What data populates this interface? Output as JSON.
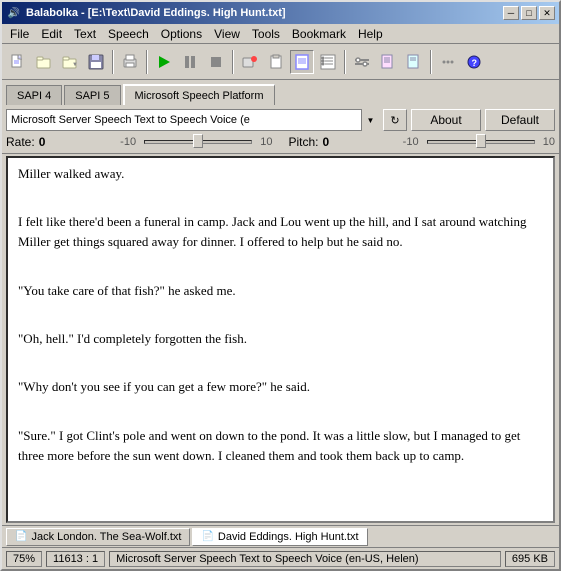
{
  "window": {
    "title": "Balabolka - [E:\\Text\\David Eddings. High Hunt.txt]",
    "icon": "🔊"
  },
  "titlebar": {
    "minimize_label": "─",
    "maximize_label": "□",
    "close_label": "✕"
  },
  "menu": {
    "items": [
      "File",
      "Edit",
      "Text",
      "Speech",
      "Options",
      "View",
      "Tools",
      "Bookmark",
      "Help"
    ]
  },
  "tabs": {
    "sapi4": "SAPI 4",
    "sapi5": "SAPI 5",
    "microsoft_speech": "Microsoft Speech Platform"
  },
  "voice": {
    "selected": "Microsoft Server Speech Text to Speech Voice (e",
    "about_label": "About",
    "default_label": "Default",
    "rate_label": "Rate:",
    "rate_value": "0",
    "rate_min": "-10",
    "rate_max": "10",
    "pitch_label": "Pitch:",
    "pitch_value": "0",
    "pitch_min": "-10",
    "pitch_max": "10"
  },
  "text_content": {
    "paragraphs": [
      "Miller walked away.",
      "I felt like there'd been a funeral in camp. Jack and Lou went up the hill, and I sat around watching Miller get things squared away for dinner. I offered to help but he said no.",
      "\"You take care of that fish?\" he asked me.",
      "\"Oh, hell.\" I'd completely forgotten the fish.",
      "\"Why don't you see if you can get a few more?\" he said.",
      "\"Sure.\" I got Clint's pole and went on down to the pond. It was a little slow, but I managed to get three more before the sun went down. I cleaned them and took them back up to camp."
    ]
  },
  "doc_tabs": [
    {
      "label": "Jack London. The Sea-Wolf.txt",
      "active": false
    },
    {
      "label": "David Eddings. High Hunt.txt",
      "active": true
    }
  ],
  "status_bar": {
    "zoom": "75%",
    "position": "11613 : 1",
    "voice": "Microsoft Server Speech Text to Speech Voice (en-US, Helen)",
    "size": "695 KB"
  },
  "toolbar": {
    "buttons": [
      {
        "name": "new-button",
        "icon": "📄"
      },
      {
        "name": "open-button",
        "icon": "📂"
      },
      {
        "name": "save-button",
        "icon": "💾"
      },
      {
        "name": "print-button",
        "icon": "🖨"
      },
      {
        "name": "speak-button",
        "icon": "▶",
        "active": true
      },
      {
        "name": "pause-button",
        "icon": "⏸"
      },
      {
        "name": "stop-button",
        "icon": "⏹"
      },
      {
        "name": "rewind-button",
        "icon": "⏮"
      },
      {
        "name": "skip-button",
        "icon": "⏭"
      },
      {
        "name": "settings-button",
        "icon": "⚙"
      }
    ]
  }
}
